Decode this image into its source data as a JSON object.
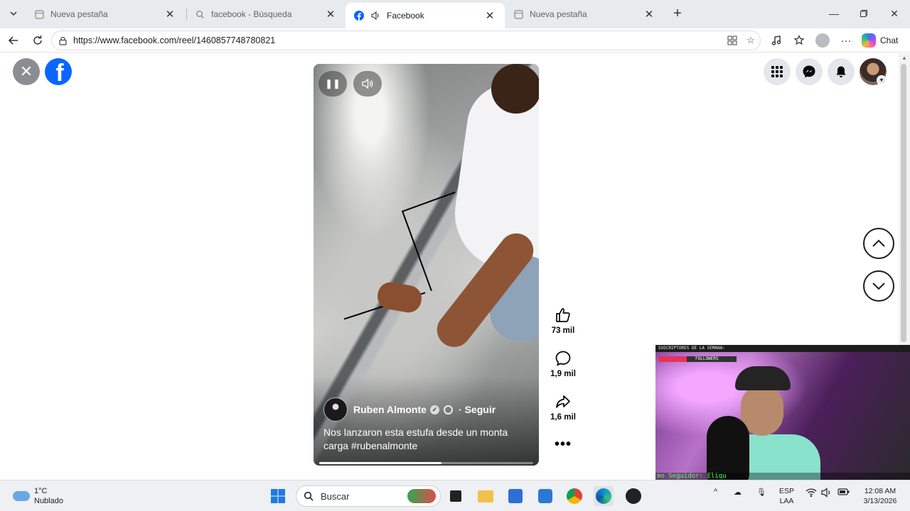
{
  "browser": {
    "tabs": [
      {
        "label": "Nueva pestaña",
        "icon": "newtab-page-icon",
        "active": false
      },
      {
        "label": "facebook - Búsqueda",
        "icon": "search-icon",
        "active": false
      },
      {
        "label": "Facebook",
        "icon": "facebook-icon",
        "active": true,
        "audio": true
      },
      {
        "label": "Nueva pestaña",
        "icon": "newtab-page-icon",
        "active": false
      }
    ],
    "url": "https://www.facebook.com/reel/1460857748780821",
    "chat_label": "Chat"
  },
  "reel": {
    "author": "Ruben Almonte",
    "follow_label": "Seguir",
    "caption": "Nos lanzaron esta estufa desde un monta carga",
    "hashtag": "#rubenalmonte",
    "progress": 0.57,
    "likes": "73 mil",
    "comments": "1,9 mil",
    "shares": "1,6 mil"
  },
  "stream_overlay": {
    "header": "SUSCRIPTORES DE LA SEMANA:",
    "followers_label": "FOLLOWERS",
    "ticker": "mo Seguidor: Eliqu"
  },
  "taskbar": {
    "weather_temp": "1°C",
    "weather_desc": "Nublado",
    "search_placeholder": "Buscar",
    "lang_line1": "ESP",
    "lang_line2": "LAA",
    "time": "12:08 AM",
    "date": "3/13/2026"
  },
  "colors": {
    "facebook_blue": "#0866ff",
    "tab_strip": "#e8ebee",
    "taskbar": "#eef0f3"
  }
}
